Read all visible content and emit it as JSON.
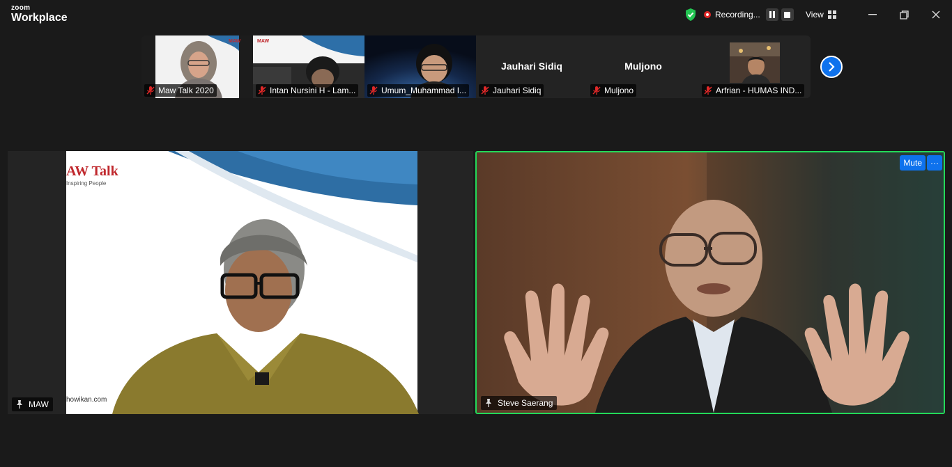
{
  "app": {
    "brand_small": "zoom",
    "brand_big": "Workplace"
  },
  "toolbar": {
    "recording_label": "Recording...",
    "view_label": "View"
  },
  "strip": {
    "participants": [
      {
        "name": "Maw Talk 2020",
        "video": true
      },
      {
        "name": "Intan Nursini H - Lam...",
        "video": true
      },
      {
        "name": "Umum_Muhammad I...",
        "video": true
      },
      {
        "name": "Jauhari Sidiq",
        "display": "Jauhari Sidiq",
        "video": false
      },
      {
        "name": "Muljono",
        "display": "Muljono",
        "video": false
      },
      {
        "name": "Arfrian - HUMAS IND...",
        "video": true
      }
    ]
  },
  "main": {
    "left": {
      "name": "MAW",
      "logo_text": "AW Talk",
      "logo_sub": "Inspiring People",
      "website": "howikan.com"
    },
    "right": {
      "name": "Steve Saerang",
      "mute_label": "Mute",
      "more_label": "···"
    }
  },
  "colors": {
    "accent": "#0e72ed",
    "active_speaker": "#23d959",
    "record": "#e02828",
    "muted": "#e02828"
  }
}
